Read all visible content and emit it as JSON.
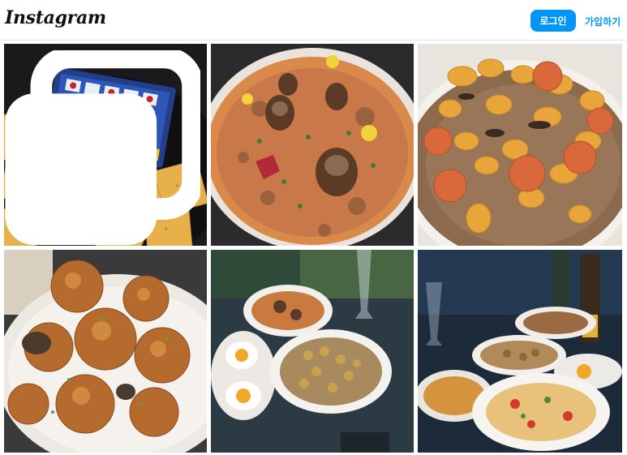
{
  "header": {
    "logo_text": "Instagram",
    "login_label": "로그인",
    "signup_label": "가입하기"
  },
  "posts": [
    {
      "subject": "crackers-and-chocolate-box",
      "multi": true,
      "icon": "multiple-images-icon"
    },
    {
      "subject": "mushroom-pizza"
    },
    {
      "subject": "gnocchi-with-scallops"
    },
    {
      "subject": "fried-chicken-bites"
    },
    {
      "subject": "table-spread-dishes"
    },
    {
      "subject": "wine-and-pasta-table"
    }
  ]
}
